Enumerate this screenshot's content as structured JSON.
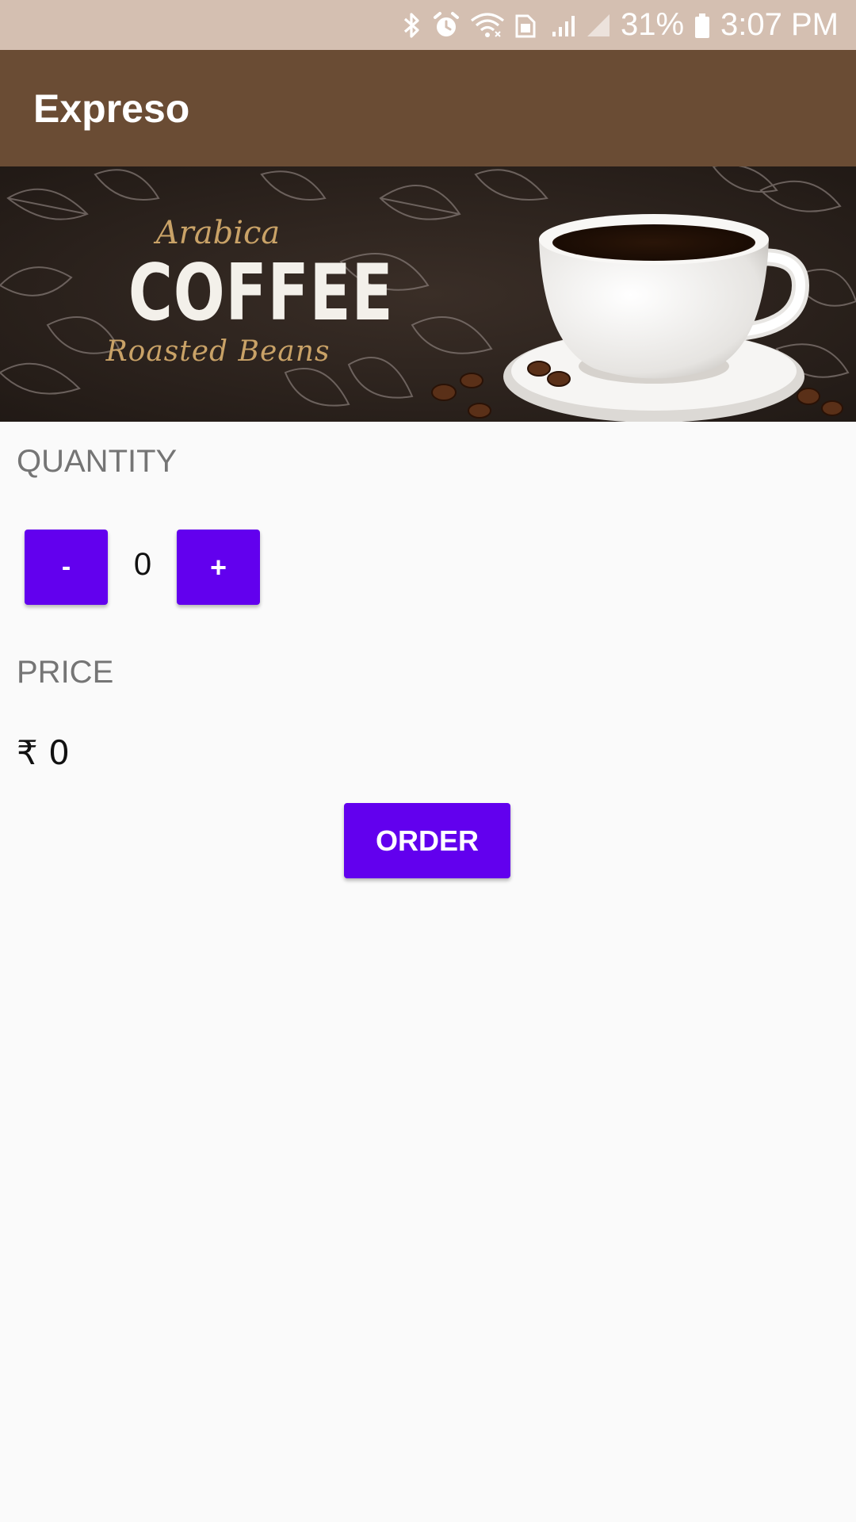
{
  "status_bar": {
    "battery": "31%",
    "time": "3:07 PM",
    "icons": [
      "bluetooth-icon",
      "alarm-icon",
      "wifi-icon",
      "sim-icon",
      "signal-icon",
      "signal-empty-icon",
      "battery-icon"
    ],
    "background": "#d4bfb1"
  },
  "app_bar": {
    "title": "Expreso",
    "background": "#6a4c34"
  },
  "banner": {
    "script_top": "Arabica",
    "headline": "COFFEE",
    "script_bottom": "Roasted Beans"
  },
  "quantity": {
    "label": "QUANTITY",
    "decrement_label": "-",
    "value": "0",
    "increment_label": "+"
  },
  "price": {
    "label": "PRICE",
    "value": "₹ 0"
  },
  "order_button": {
    "label": "ORDER"
  },
  "colors": {
    "accent": "#6200ee",
    "label_gray": "#757575",
    "background": "#fafafa"
  }
}
